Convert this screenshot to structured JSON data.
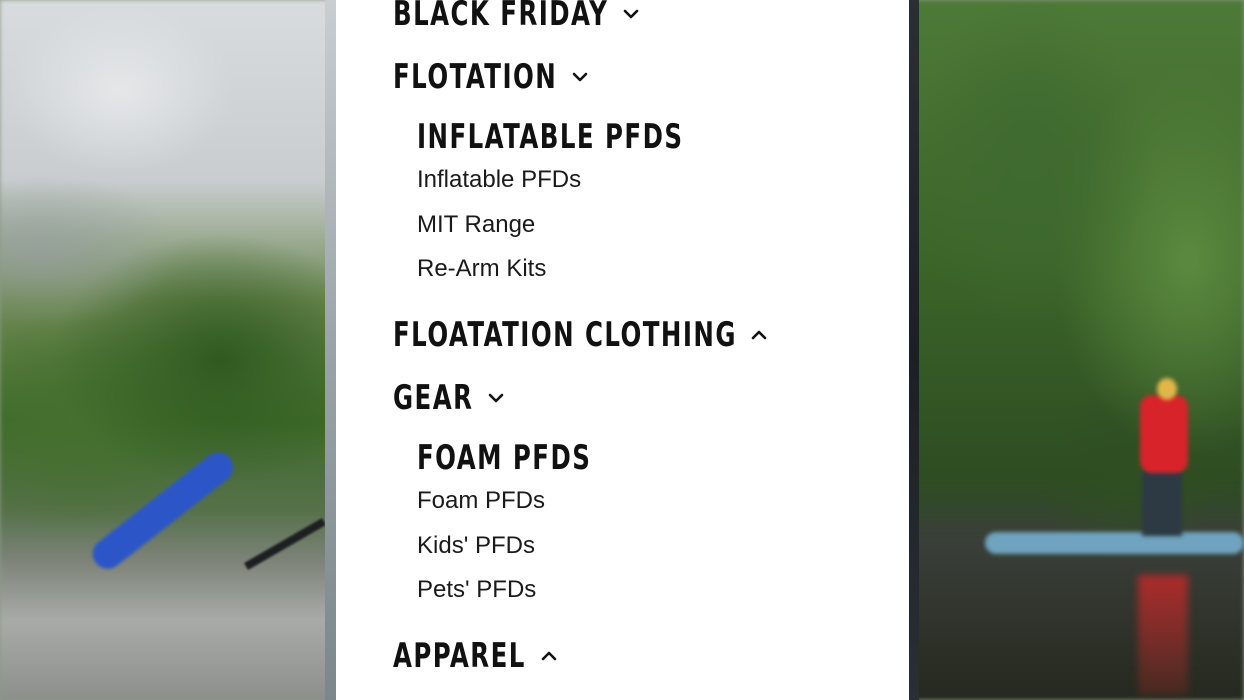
{
  "menu": {
    "black_friday": {
      "label": "BLACK FRIDAY",
      "chevron": "chevron-down-icon"
    },
    "flotation": {
      "label": "FLOTATION",
      "chevron": "chevron-down-icon",
      "group_title": "INFLATABLE PFDS",
      "links": [
        "Inflatable PFDs",
        "MIT Range",
        "Re-Arm Kits"
      ]
    },
    "floatation_clothing": {
      "label": "FLOATATION CLOTHING",
      "chevron": "chevron-up-icon"
    },
    "gear": {
      "label": "GEAR",
      "chevron": "chevron-down-icon",
      "group_title": "FOAM PFDS",
      "links": [
        "Foam PFDs",
        "Kids' PFDs",
        "Pets' PFDs"
      ]
    },
    "apparel": {
      "label": "APPAREL",
      "chevron": "chevron-up-icon"
    }
  },
  "colors": {
    "panel_bg": "#ffffff",
    "text": "#111111",
    "paddle": "#2c56c8",
    "person_jacket": "#d8232a"
  }
}
